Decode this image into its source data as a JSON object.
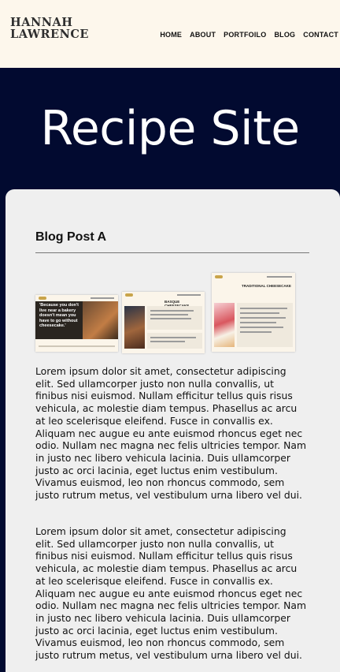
{
  "header": {
    "logo_line1": "HANNAH",
    "logo_line2": "LAWRENCE",
    "nav": [
      "HOME",
      "ABOUT",
      "PORTFOILO",
      "BLOG",
      "CONTACT"
    ]
  },
  "hero": {
    "title": "Recipe Site"
  },
  "post": {
    "title": "Blog Post A",
    "screenshots": {
      "quote": "'Because you don't live near a bakery doesn't mean you have to go without cheesecake.'",
      "basque_title": "BASQUE CHEESECAKE",
      "traditional_title": "TRADITIONAL CHEESECAKE"
    },
    "paragraphs": [
      "Lorem ipsum dolor sit amet, consectetur adipiscing elit. Sed ullamcorper justo non nulla convallis, ut finibus nisi euismod. Nullam efficitur tellus quis risus vehicula, ac molestie diam tempus. Phasellus ac arcu at leo scelerisque eleifend. Fusce in convallis ex. Aliquam nec augue eu ante euismod rhoncus eget nec odio. Nullam nec magna nec felis ultricies tempor. Nam in justo nec libero vehicula lacinia. Duis ullamcorper justo ac orci lacinia, eget luctus enim vestibulum. Vivamus euismod, leo non rhoncus commodo, sem justo rutrum metus, vel vestibulum urna libero vel dui.",
      "Lorem ipsum dolor sit amet, consectetur adipiscing elit. Sed ullamcorper justo non nulla convallis, ut finibus nisi euismod. Nullam efficitur tellus quis risus vehicula, ac molestie diam tempus. Phasellus ac arcu at leo scelerisque eleifend. Fusce in convallis ex. Aliquam nec augue eu ante euismod rhoncus eget nec odio. Nullam nec magna nec felis ultricies tempor. Nam in justo nec libero vehicula lacinia. Duis ullamcorper justo ac orci lacinia, eget luctus enim vestibulum. Vivamus euismod, leo non rhoncus commodo, sem justo rutrum metus, vel vestibulum urna libero vel dui."
    ]
  },
  "colors": {
    "header_bg": "#fdf7ec",
    "hero_bg": "#020a30",
    "card_bg": "#efefef",
    "text": "#111111"
  }
}
